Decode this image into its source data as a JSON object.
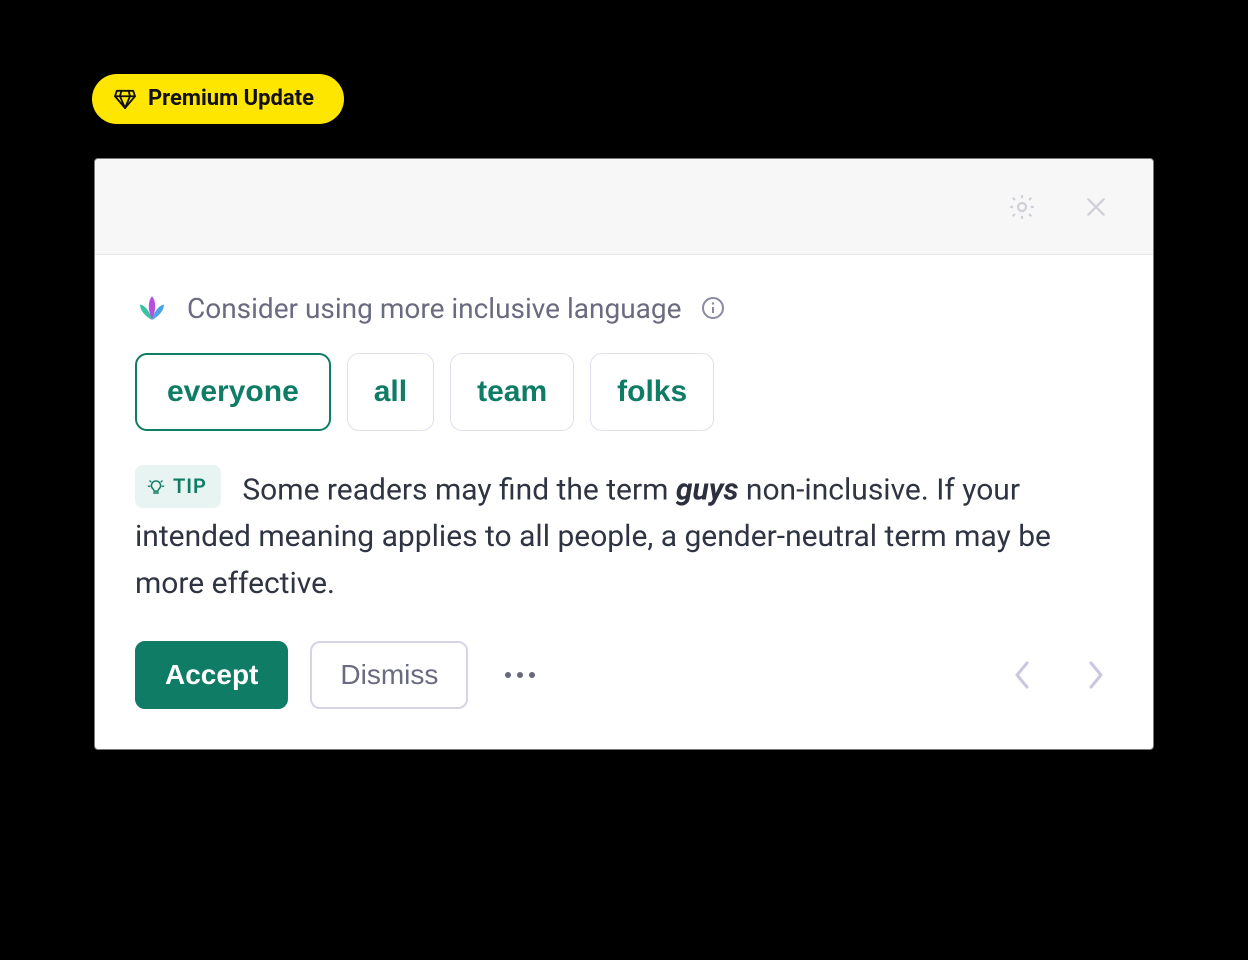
{
  "badge": {
    "label": "Premium Update"
  },
  "card": {
    "title": "Consider using more inclusive language",
    "suggestions": [
      {
        "label": "everyone",
        "primary": true
      },
      {
        "label": "all",
        "primary": false
      },
      {
        "label": "team",
        "primary": false
      },
      {
        "label": "folks",
        "primary": false
      }
    ],
    "tip": {
      "badge": "TIP",
      "pre": "Some readers may find the term ",
      "term": "guys",
      "post": " non-inclusive. If your intended meaning applies to all people, a gender-neutral term may be more effective."
    },
    "actions": {
      "accept": "Accept",
      "dismiss": "Dismiss"
    }
  }
}
